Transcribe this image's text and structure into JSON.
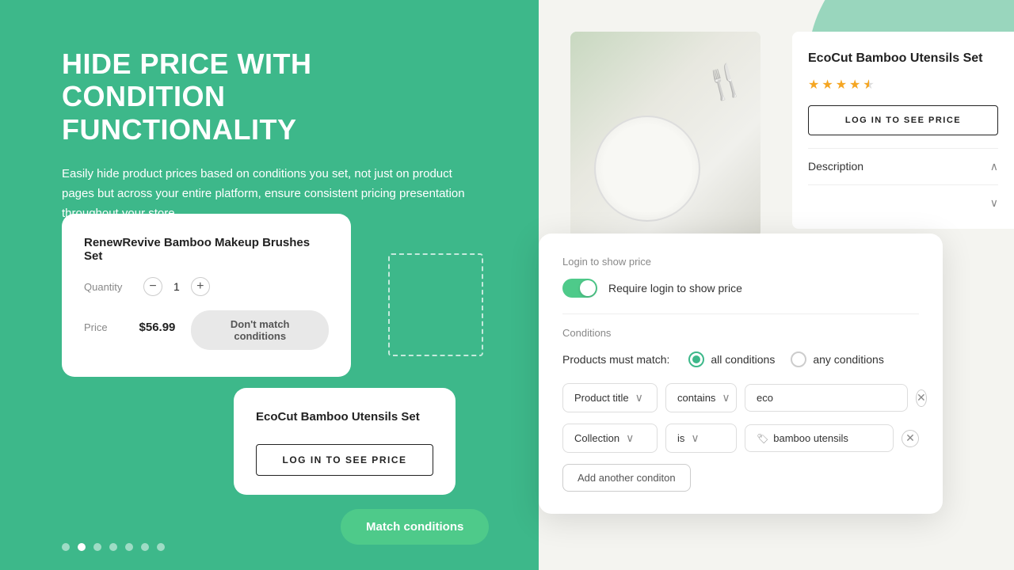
{
  "left": {
    "title_line1": "HIDE PRICE WITH CONDITION",
    "title_line2": "FUNCTIONALITY",
    "description": "Easily hide product prices based on conditions you set, not just on product pages but across your entire platform, ensure consistent pricing presentation throughout your store.",
    "card1": {
      "title": "RenewRevive Bamboo Makeup Brushes Set",
      "quantity_label": "Quantity",
      "quantity_value": "1",
      "price_label": "Price",
      "price_value": "$56.99",
      "dont_match_btn": "Don't match conditions"
    },
    "card2": {
      "title": "EcoCut Bamboo Utensils Set",
      "log_btn": "LOG IN TO SEE PRICE"
    },
    "match_btn": "Match conditions"
  },
  "right": {
    "product": {
      "name": "EcoCut Bamboo Utensils Set",
      "stars": [
        1,
        1,
        1,
        1,
        0.5
      ],
      "log_btn": "LOG IN TO SEE PRICE",
      "description_label": "Description"
    }
  },
  "conditions_panel": {
    "login_section_label": "Login to show price",
    "toggle_label": "Require login to show price",
    "conditions_label": "Conditions",
    "match_label": "Products must match:",
    "all_conditions": "all conditions",
    "any_conditions": "any conditions",
    "rows": [
      {
        "field": "Product title",
        "operator": "contains",
        "value": "eco",
        "has_tag_icon": false
      },
      {
        "field": "Collection",
        "operator": "is",
        "value": "bamboo utensils",
        "has_tag_icon": true
      }
    ],
    "add_btn": "Add another conditon"
  },
  "carousel": {
    "dots": [
      false,
      true,
      false,
      false,
      false,
      false,
      false
    ],
    "active_index": 1
  }
}
